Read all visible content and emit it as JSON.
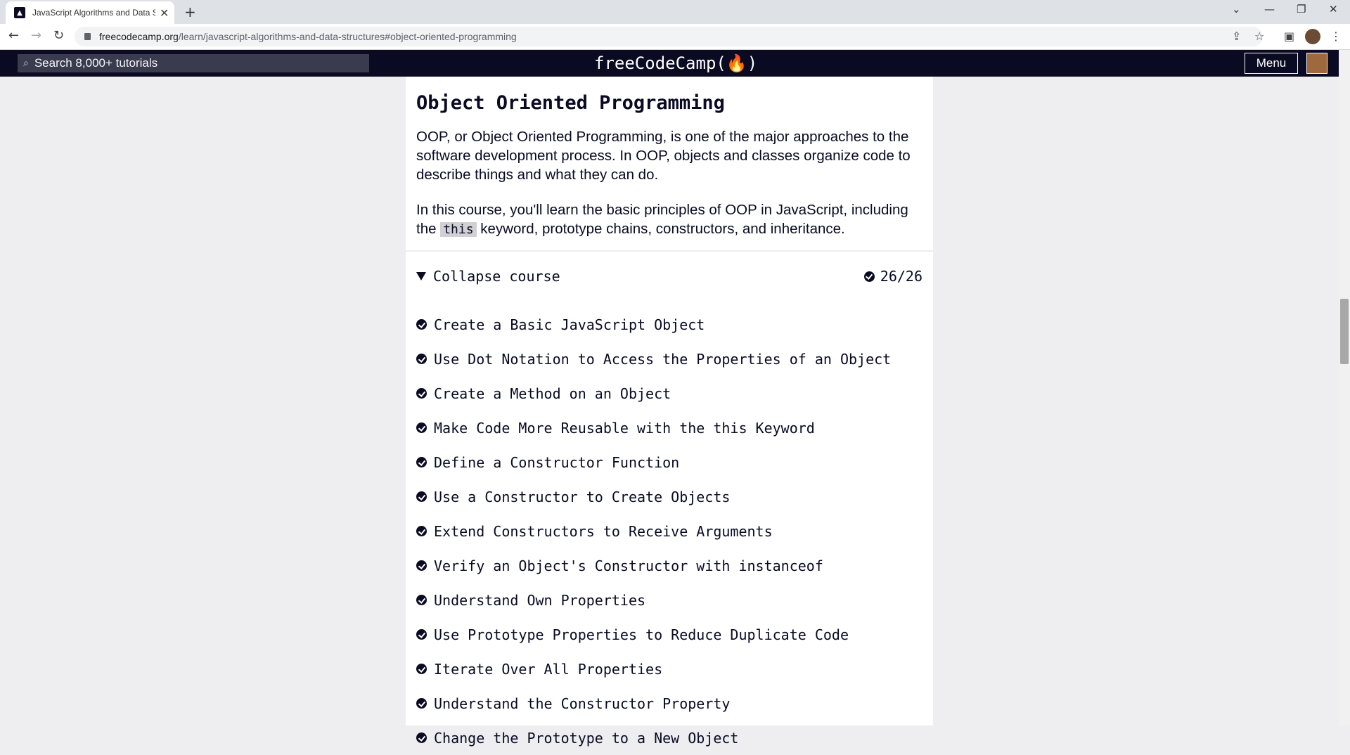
{
  "browser": {
    "tab_title": "JavaScript Algorithms and Data S",
    "url_host": "freecodecamp.org",
    "url_path": "/learn/javascript-algorithms-and-data-structures#object-oriented-programming"
  },
  "fcc_nav": {
    "search_placeholder": "Search 8,000+ tutorials",
    "logo": "freeCodeCamp(🔥)",
    "menu_label": "Menu"
  },
  "section": {
    "title": "Object Oriented Programming",
    "intro": "OOP, or Object Oriented Programming, is one of the major approaches to the software development process. In OOP, objects and classes organize code to describe things and what they can do.",
    "para2_before": "In this course, you'll learn the basic principles of OOP in JavaScript, including the ",
    "para2_code": "this",
    "para2_after": " keyword, prototype chains, constructors, and inheritance."
  },
  "course": {
    "collapse_label": "Collapse course",
    "progress": "26/26",
    "challenges": [
      "Create a Basic JavaScript Object",
      "Use Dot Notation to Access the Properties of an Object",
      "Create a Method on an Object",
      "Make Code More Reusable with the this Keyword",
      "Define a Constructor Function",
      "Use a Constructor to Create Objects",
      "Extend Constructors to Receive Arguments",
      "Verify an Object's Constructor with instanceof",
      "Understand Own Properties",
      "Use Prototype Properties to Reduce Duplicate Code",
      "Iterate Over All Properties",
      "Understand the Constructor Property",
      "Change the Prototype to a New Object"
    ]
  }
}
